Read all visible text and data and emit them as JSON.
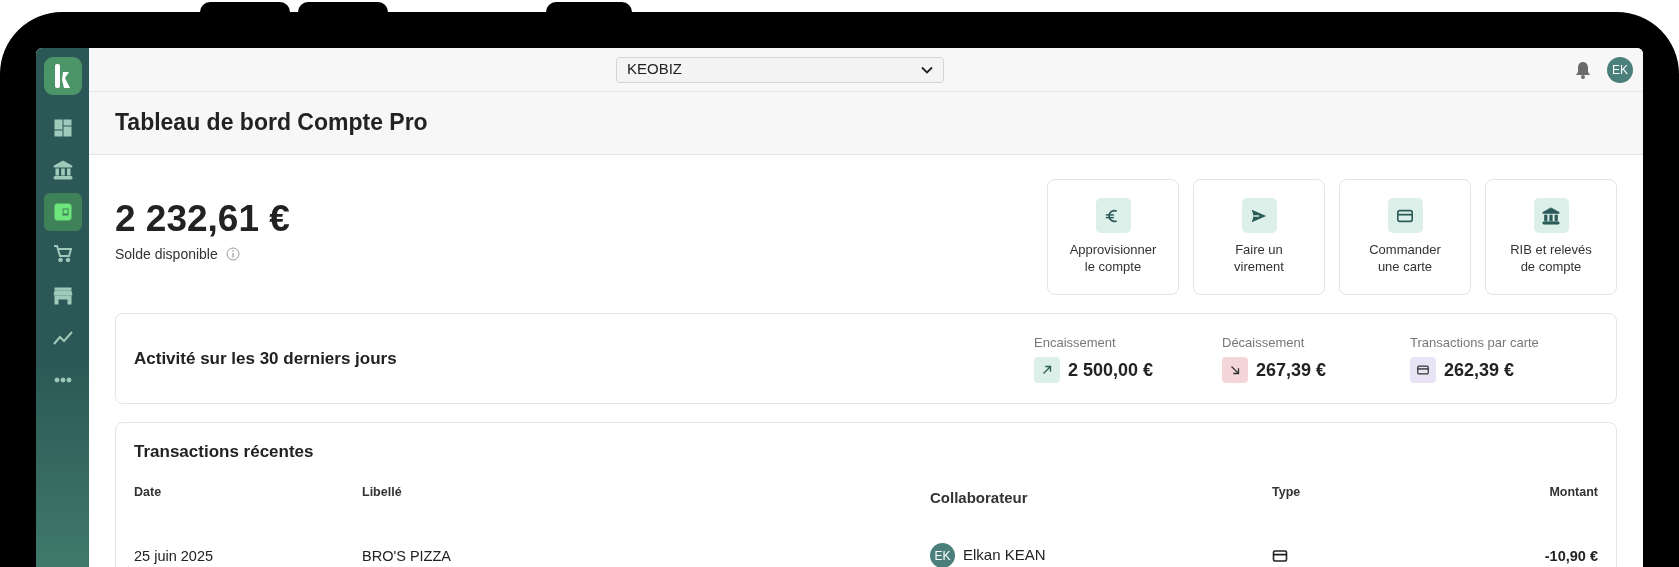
{
  "top_bar": {
    "company_select": "KEOBIZ",
    "avatar": "EK"
  },
  "sidebar": {
    "items": [
      {
        "kind": "dashboard",
        "selected": false
      },
      {
        "kind": "bank",
        "selected": false
      },
      {
        "kind": "wallet",
        "selected": true
      },
      {
        "kind": "cart",
        "selected": false
      },
      {
        "kind": "store",
        "selected": false
      },
      {
        "kind": "chart",
        "selected": false
      },
      {
        "kind": "more",
        "selected": false
      }
    ]
  },
  "page": {
    "title": "Tableau de bord Compte Pro"
  },
  "balance": {
    "amount": "2 232,61 €",
    "label": "Solde disponible"
  },
  "actions": [
    {
      "kind": "euro",
      "lines": [
        "Approvisionner",
        "le compte"
      ]
    },
    {
      "kind": "send",
      "lines": [
        "Faire un",
        "virement"
      ]
    },
    {
      "kind": "card",
      "lines": [
        "Commander",
        "une carte"
      ]
    },
    {
      "kind": "bank",
      "lines": [
        "RIB et relevés",
        "de compte"
      ]
    }
  ],
  "activity": {
    "title": "Activité sur les 30 derniers jours",
    "metrics": [
      {
        "kind": "in",
        "label": "Encaissement",
        "value": "2 500,00 €"
      },
      {
        "kind": "out",
        "label": "Décaissement",
        "value": "267,39 €"
      },
      {
        "kind": "card",
        "label": "Transactions par carte",
        "value": "262,39 €"
      }
    ]
  },
  "transactions": {
    "title": "Transactions récentes",
    "columns": [
      "Date",
      "Libellé",
      "Collaborateur",
      "Type",
      "Montant"
    ],
    "rows": [
      {
        "date": "25 juin 2025",
        "label": "BRO'S PIZZA",
        "collaborator": {
          "initials": "EK",
          "name": "Elkan KEAN"
        },
        "kind": "card",
        "amount": "-10,90 €"
      }
    ]
  }
}
